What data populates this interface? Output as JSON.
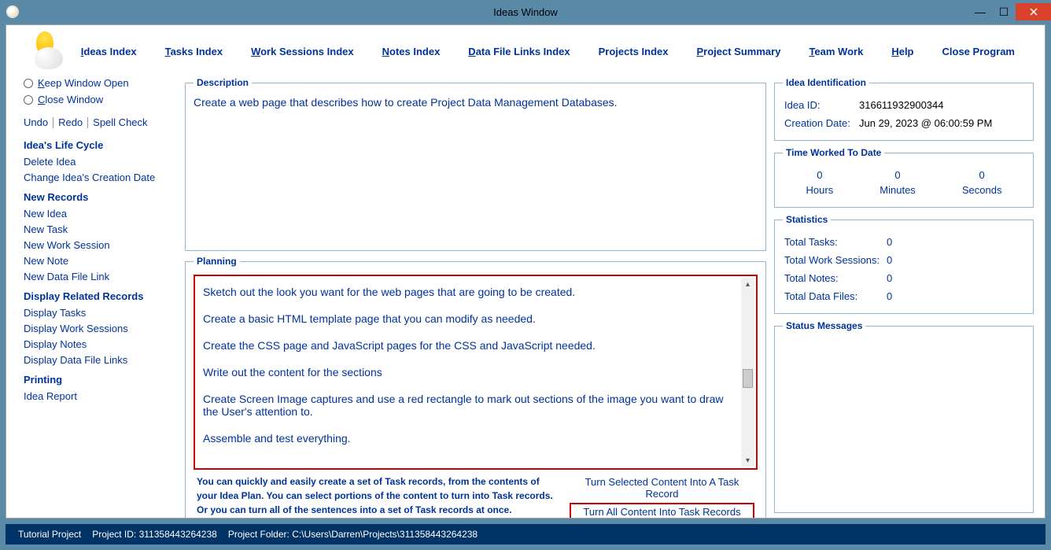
{
  "window_title": "Ideas Window",
  "menu": {
    "ideas_index": "Ideas Index",
    "ideas_index_u": "I",
    "tasks_index": "Tasks Index",
    "tasks_index_u": "T",
    "work_index": "Work Sessions Index",
    "work_index_u": "W",
    "notes_index": "Notes Index",
    "notes_index_u": "N",
    "data_index": "Data File Links Index",
    "data_index_u": "D",
    "projects_index": "Projects Index",
    "project_summary": "Project Summary",
    "project_summary_u": "P",
    "team_work": "Team Work",
    "team_work_u": "T",
    "help": "Help",
    "help_u": "H",
    "close_program": "Close Program"
  },
  "left": {
    "keep_open": "Keep Window Open",
    "keep_u": "K",
    "close_win": "Close Window",
    "close_u": "C",
    "undo": "Undo",
    "redo": "Redo",
    "spell": "Spell Check",
    "life_cycle": "Idea's Life Cycle",
    "delete_idea": "Delete Idea",
    "change_date": "Change Idea's Creation Date",
    "new_records": "New Records",
    "new_idea": "New Idea",
    "new_task": "New Task",
    "new_work": "New Work Session",
    "new_note": "New Note",
    "new_dfl": "New Data File Link",
    "display_related": "Display Related Records",
    "disp_tasks": "Display Tasks",
    "disp_work": "Display Work Sessions",
    "disp_notes": "Display Notes",
    "disp_dfl": "Display Data File Links",
    "printing": "Printing",
    "idea_report": "Idea Report"
  },
  "description_label": "Description",
  "description_text": "Create a web page that describes how to create Project Data Management Databases.",
  "planning_label": "Planning",
  "planning": {
    "p1": "Sketch out the look you want for the web pages that are going to be created.",
    "p2": "Create a basic HTML template page that you can modify as needed.",
    "p3": "Create the CSS page and JavaScript pages for the CSS and JavaScript needed.",
    "p4": "Write out the content for the sections",
    "p5": "Create Screen Image captures and use a red rectangle to mark out sections of the image you want to draw the User's attention to.",
    "p6": "Assemble and test everything."
  },
  "help_text": "You can quickly and easily create a set of Task records, from the contents of your Idea Plan. You can select portions of the content to turn into Task records. Or you can turn all of the sentences into a set of Task records at once.",
  "task_links": {
    "selected": "Turn Selected Content Into A Task Record",
    "all": "Turn All Content Into Task Records"
  },
  "right": {
    "idea_ident": "Idea Identification",
    "idea_id_label": "Idea ID:",
    "idea_id": "316611932900344",
    "creation_label": "Creation Date:",
    "creation_date": "Jun  29, 2023 @ 06:00:59 PM",
    "time_worked": "Time Worked To Date",
    "hours_v": "0",
    "hours_l": "Hours",
    "minutes_v": "0",
    "minutes_l": "Minutes",
    "seconds_v": "0",
    "seconds_l": "Seconds",
    "stats": "Statistics",
    "tot_tasks_l": "Total Tasks:",
    "tot_tasks_v": "0",
    "tot_ws_l": "Total Work Sessions:",
    "tot_ws_v": "0",
    "tot_notes_l": "Total Notes:",
    "tot_notes_v": "0",
    "tot_df_l": "Total Data Files:",
    "tot_df_v": "0",
    "status_msg": "Status Messages"
  },
  "status": {
    "project_name": "Tutorial Project",
    "project_id": "Project ID: 311358443264238",
    "project_folder": "Project Folder: C:\\Users\\Darren\\Projects\\311358443264238"
  }
}
